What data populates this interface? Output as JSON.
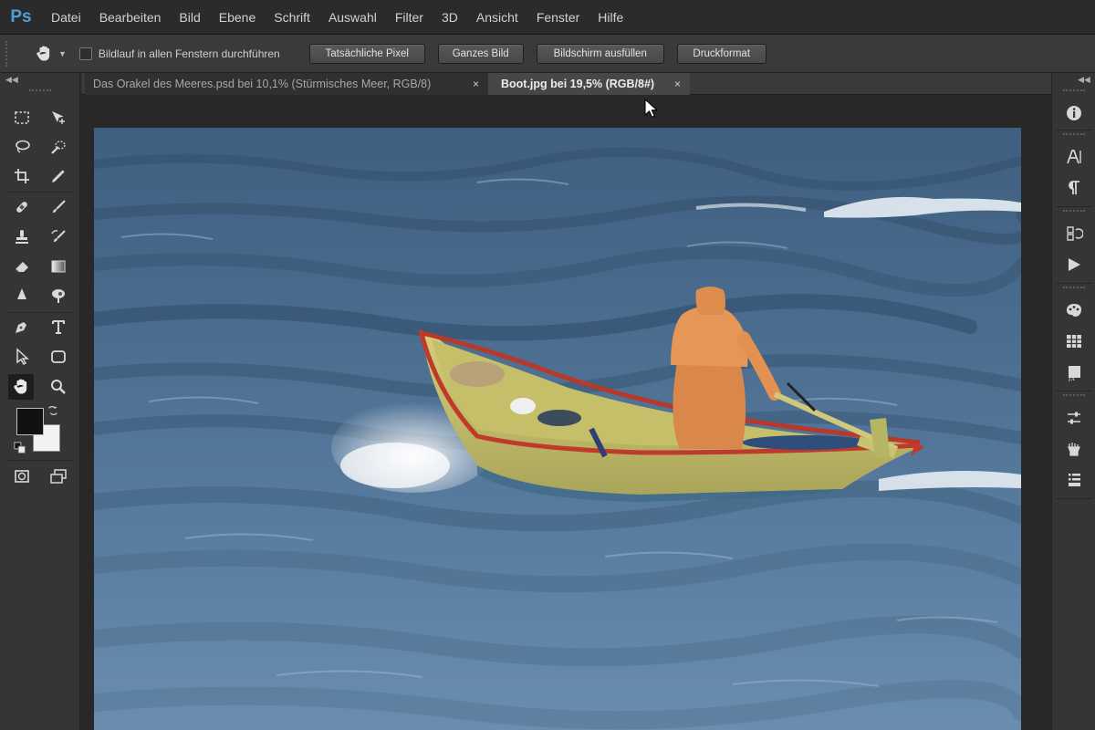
{
  "app": {
    "logo": "Ps",
    "menu": [
      "Datei",
      "Bearbeiten",
      "Bild",
      "Ebene",
      "Schrift",
      "Auswahl",
      "Filter",
      "3D",
      "Ansicht",
      "Fenster",
      "Hilfe"
    ]
  },
  "options_bar": {
    "tool_icon": "hand-icon",
    "checkbox_label": "Bildlauf in allen Fenstern durchführen",
    "checkbox_checked": false,
    "buttons": {
      "actual_pixels": "Tatsächliche Pixel",
      "fit_screen": "Ganzes Bild",
      "fill_screen": "Bildschirm ausfüllen",
      "print_size": "Druckformat"
    }
  },
  "tabs": [
    {
      "label": "Das Orakel des Meeres.psd bei 10,1% (Stürmisches Meer, RGB/8)",
      "active": false,
      "close": "×"
    },
    {
      "label": "Boot.jpg bei 19,5% (RGB/8#)",
      "active": true,
      "close": "×"
    }
  ],
  "tools": {
    "active": "hand-tool",
    "foreground_color": "#111111",
    "background_color": "#f2f2f2"
  },
  "colors": {
    "app_bg": "#282828",
    "panel_bg": "#353535",
    "accent": "#4f9ed8"
  },
  "right_dock_icons": [
    "info-icon",
    "character-icon",
    "paragraph-icon",
    "history-icon",
    "actions-icon",
    "color-icon",
    "swatches-icon",
    "styles-icon",
    "adjustments-icon",
    "properties-icon",
    "layers-icon"
  ]
}
